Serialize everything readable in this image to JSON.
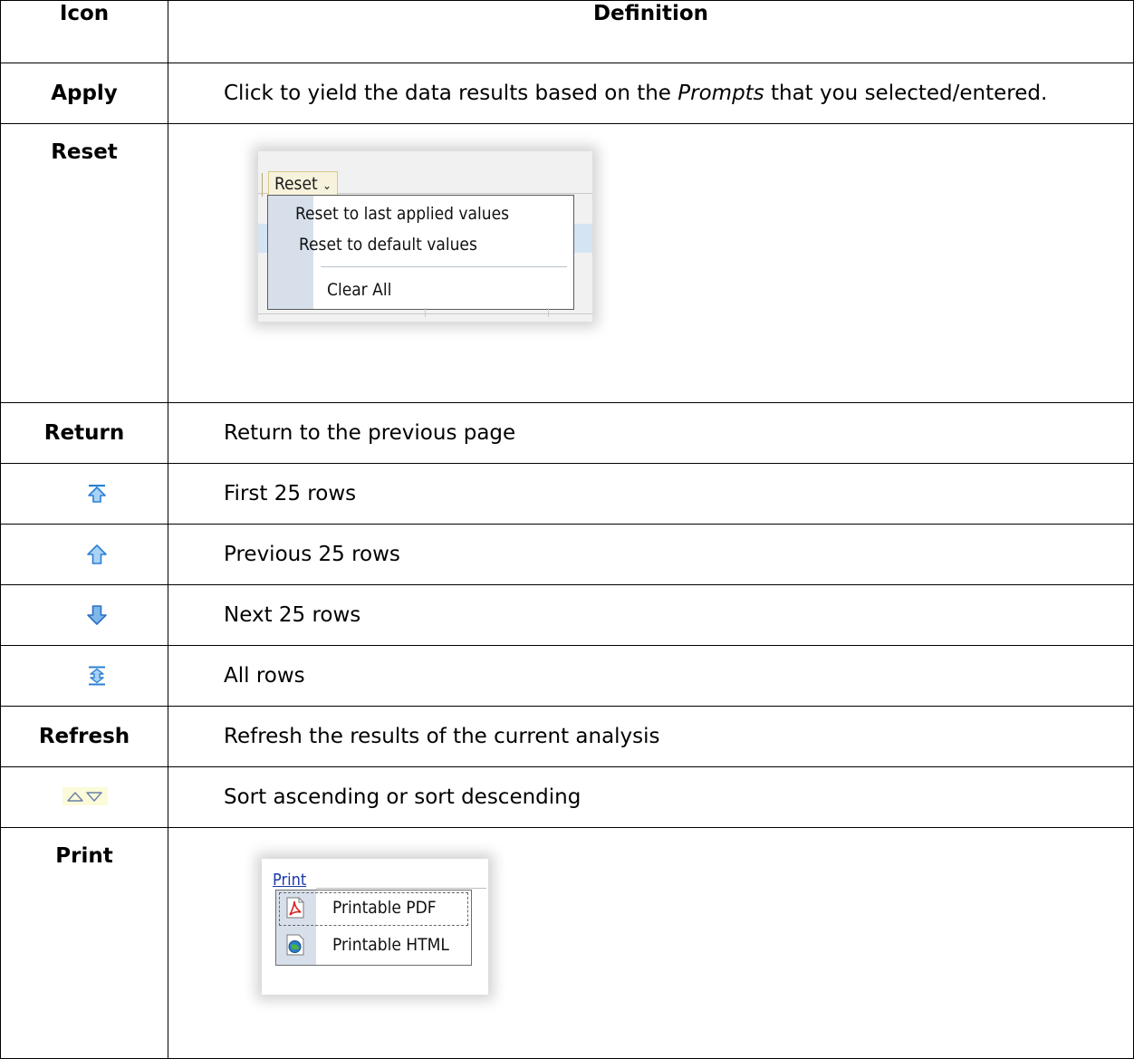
{
  "table": {
    "header": {
      "icon": "Icon",
      "definition": "Definition"
    },
    "rows": {
      "apply": {
        "icon_label": "Apply",
        "def_before": "Click to yield the data results based on the ",
        "def_em": "Prompts",
        "def_after": " that you selected/entered."
      },
      "reset": {
        "icon_label": "Reset",
        "screenshot": {
          "button_label": "Reset",
          "button_chevron": "⌄",
          "menu_items": [
            "Reset to last applied values",
            "Reset to default values",
            "Clear All"
          ]
        }
      },
      "return": {
        "icon_label": "Return",
        "definition": "Return to the previous page"
      },
      "first": {
        "icon": "first-rows-icon",
        "definition": "First 25 rows"
      },
      "previous": {
        "icon": "previous-rows-icon",
        "definition": "Previous 25 rows"
      },
      "next": {
        "icon": "next-rows-icon",
        "definition": "Next 25 rows"
      },
      "all": {
        "icon": "all-rows-icon",
        "definition": "All rows"
      },
      "refresh": {
        "icon_label": "Refresh",
        "definition": "Refresh the results of the current analysis"
      },
      "sort": {
        "icon": "sort-ascending-descending-icon",
        "definition": "Sort ascending or sort descending"
      },
      "print": {
        "icon_label": "Print",
        "screenshot": {
          "link_label": "Print",
          "menu_items": [
            {
              "label": "Printable PDF",
              "icon": "pdf-icon"
            },
            {
              "label": "Printable HTML",
              "icon": "html-globe-icon"
            }
          ]
        }
      }
    }
  },
  "colors": {
    "arrow_blue": "#2b7fd4",
    "arrow_light": "#a9d3f5",
    "link_blue": "#1b3aa8",
    "menu_gutter": "#d7e0ea"
  }
}
